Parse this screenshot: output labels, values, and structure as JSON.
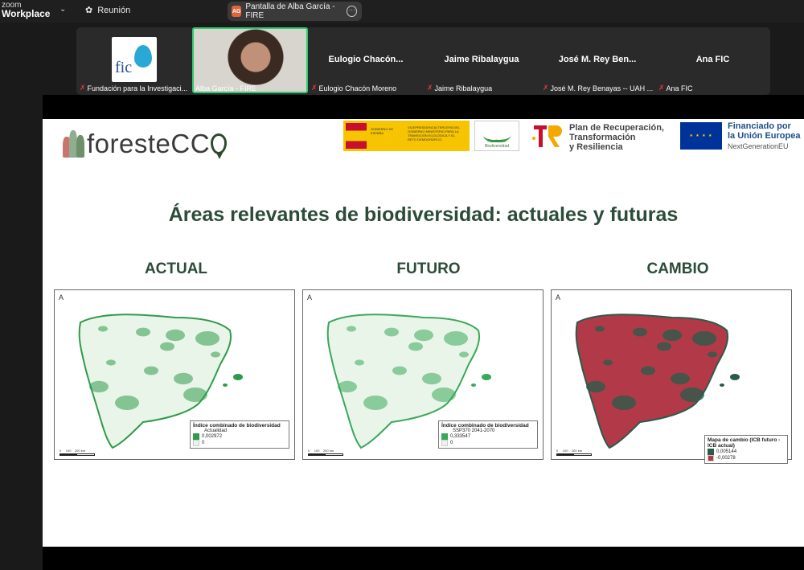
{
  "topbar": {
    "app_line1": "zoom",
    "app_line2": "Workplace",
    "meeting_label": "Reunión",
    "share_badge": "AG",
    "share_label": "Pantalla de Alba García - FIRE"
  },
  "gallery": [
    {
      "name_center": "",
      "caption": "Fundación para la Investigaci..."
    },
    {
      "name_center": "",
      "caption": "Alba García - FIRE"
    },
    {
      "name_center": "Eulogio  Chacón...",
      "caption": "Eulogio Chacón Moreno"
    },
    {
      "name_center": "Jaime Ribalaygua",
      "caption": "Jaime Ribalaygua"
    },
    {
      "name_center": "José M. Rey Ben...",
      "caption": "José M. Rey Benayas -- UAH ..."
    },
    {
      "name_center": "Ana FIC",
      "caption": "Ana FIC"
    }
  ],
  "fic_logo_text": "fic",
  "slide": {
    "brand": "foresteCC",
    "gob_text1": "GOBIERNO DE ESPAÑA",
    "gob_text2": "VICEPRESIDENCIA TERCERA DEL GOBIERNO MINISTERIO PARA LA TRANSICIÓN ECOLÓGICA Y EL RETO DEMOGRÁFICO",
    "fbio_label": "Fundación Biodiversidad",
    "prtr_text": [
      "Plan de Recuperación,",
      "Transformación",
      "y Resiliencia"
    ],
    "eu_text": [
      "Financiado por",
      "la Unión Europea"
    ],
    "eu_sub": "NextGenerationEU",
    "title": "Áreas relevantes de biodiversidad: actuales y futuras",
    "columns": [
      {
        "heading": "ACTUAL",
        "legend_title": "Índice combinado de biodiversidad",
        "legend_sub": "Actualidad",
        "legend_values": [
          "0,002972",
          "0"
        ],
        "fill": "#2f9a4a"
      },
      {
        "heading": "FUTURO",
        "legend_title": "Índice combinado de biodiversidad",
        "legend_sub": "SSP370 2041-2070",
        "legend_values": [
          "0,333547",
          "0"
        ],
        "fill": "#3aa85a"
      },
      {
        "heading": "CAMBIO",
        "legend_title": "Mapa de cambio (ICB futuro - ICB actual)",
        "legend_sub": "",
        "legend_values": [
          "0,005144",
          "-0,00278"
        ],
        "fill": "#b23a48"
      }
    ],
    "scale_labels": [
      "0",
      "100",
      "200 km"
    ],
    "north_symbol": "A"
  }
}
